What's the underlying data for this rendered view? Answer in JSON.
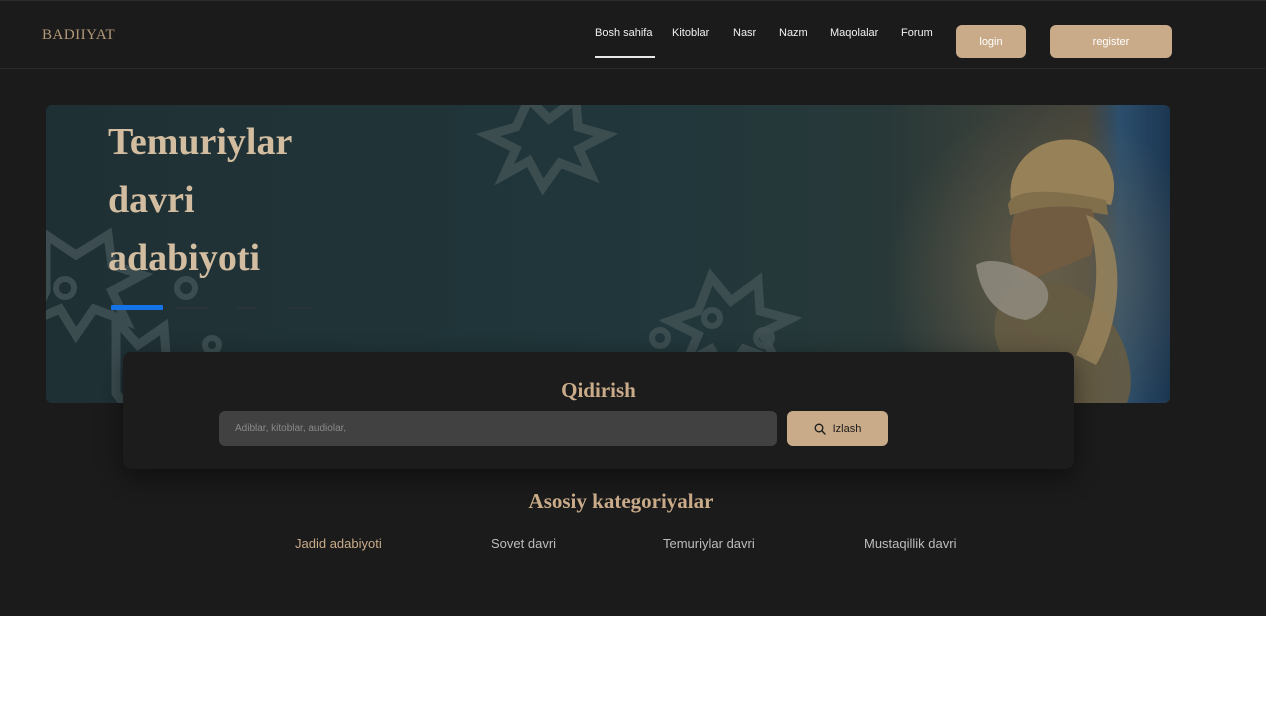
{
  "brand": {
    "logo_text": "BADIIYAT"
  },
  "nav": {
    "items": [
      {
        "label": "Bosh sahifa",
        "active": true
      },
      {
        "label": "Kitoblar"
      },
      {
        "label": "Nasr"
      },
      {
        "label": "Nazm"
      },
      {
        "label": "Maqolalar"
      },
      {
        "label": "Forum"
      }
    ],
    "login_label": "login",
    "register_label": "register"
  },
  "hero": {
    "title_lines": [
      "Temuriylar",
      "davri",
      "adabiyoti"
    ],
    "slides_total": 4,
    "active_slide": 1
  },
  "search": {
    "title": "Qidirish",
    "placeholder": "Adiblar, kitoblar, audiolar,",
    "value": "",
    "button_label": "Izlash",
    "button_icon": "search-icon"
  },
  "categories": {
    "title": "Asosiy kategoriyalar",
    "items": [
      {
        "label": "Jadid adabiyoti",
        "active": true
      },
      {
        "label": "Sovet davri"
      },
      {
        "label": "Temuriylar davri"
      },
      {
        "label": "Mustaqillik davri"
      }
    ]
  },
  "colors": {
    "background": "#1b1b1b",
    "accent": "#c9ab89",
    "hero_bg": "#243b3f",
    "slider_active": "#1473e6",
    "input_bg": "#414141"
  }
}
